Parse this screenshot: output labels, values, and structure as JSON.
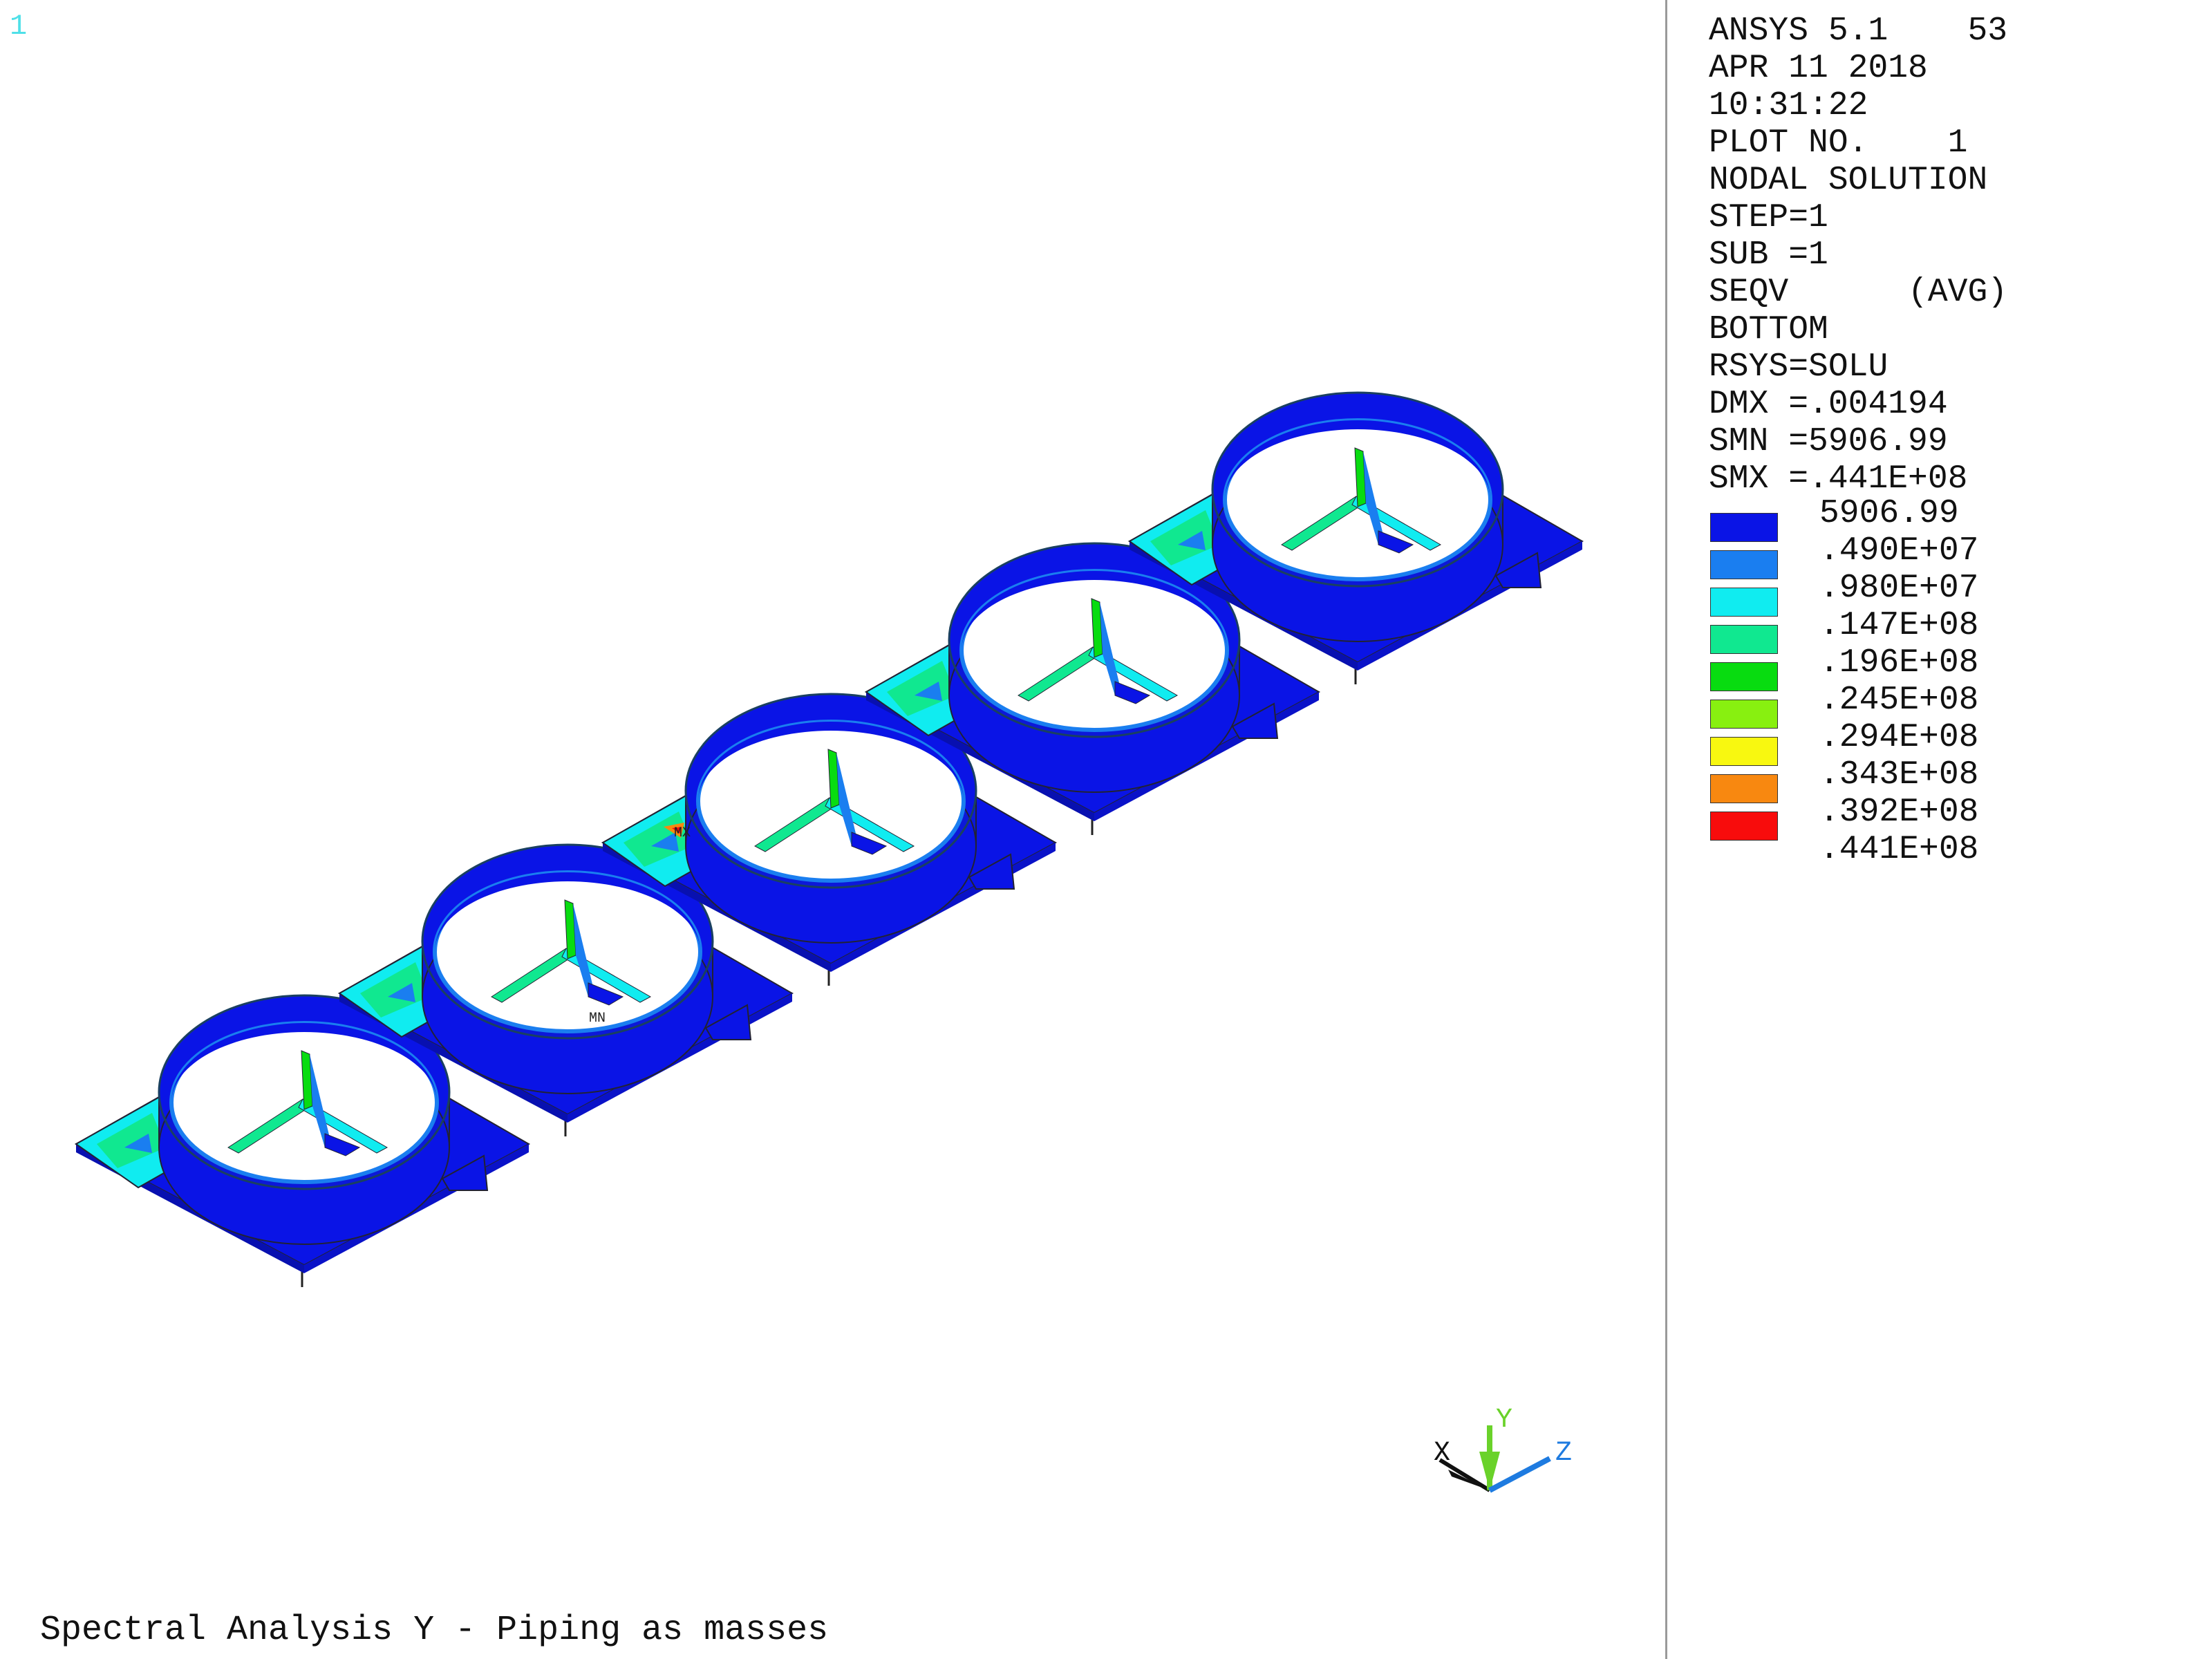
{
  "window_number": "1",
  "plot_title": "Spectral Analysis Y - Piping as masses",
  "info_lines": [
    "ANSYS 5.1    53",
    "APR 11 2018",
    "10:31:22",
    "PLOT NO.    1",
    "NODAL SOLUTION",
    "STEP=1",
    "SUB =1",
    "SEQV      (AVG)",
    "BOTTOM",
    "RSYS=SOLU",
    "DMX =.004194",
    "SMN =5906.99",
    "SMX =.441E+08"
  ],
  "contour_min_label": "5906.99",
  "contour_levels": [
    {
      "label": ".490E+07",
      "color": "#0a14e6"
    },
    {
      "label": ".980E+07",
      "color": "#1a7ef0"
    },
    {
      "label": ".147E+08",
      "color": "#10ecf0"
    },
    {
      "label": ".196E+08",
      "color": "#10e890"
    },
    {
      "label": ".245E+08",
      "color": "#08dc10"
    },
    {
      "label": ".294E+08",
      "color": "#88f010"
    },
    {
      "label": ".343E+08",
      "color": "#f8f810"
    },
    {
      "label": ".392E+08",
      "color": "#f88810"
    },
    {
      "label": ".441E+08",
      "color": "#f80c0c"
    }
  ],
  "node_markers": {
    "max": "MX",
    "min": "MN"
  },
  "triad": {
    "x": "X",
    "y": "Y",
    "z": "Z"
  },
  "colors": {
    "x_axis": "#111111",
    "y_axis": "#6ad22a",
    "z_axis": "#1e7be0",
    "base_blue": "#0a14e6",
    "mid_blue": "#1a7ef0",
    "window_number": "#4fe0e8"
  }
}
